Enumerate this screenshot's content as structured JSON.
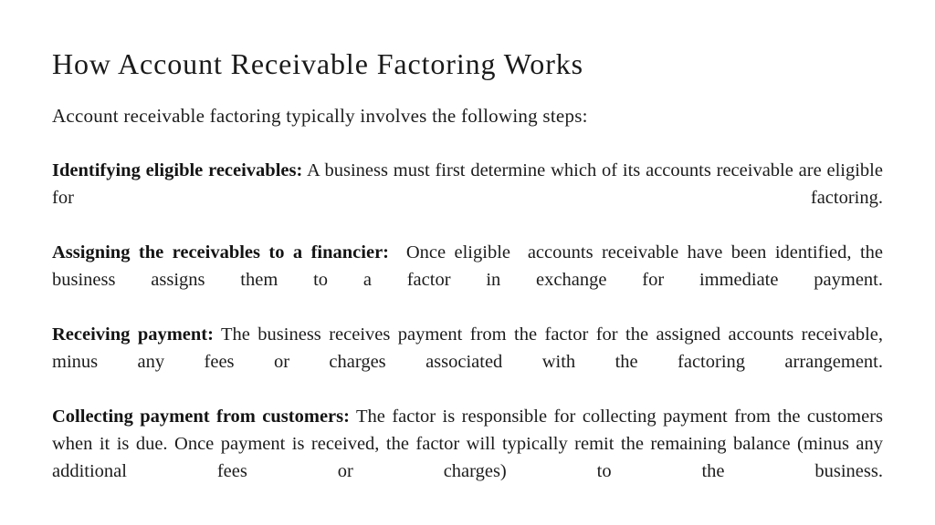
{
  "slide": {
    "title": "How Account Receivable Factoring Works",
    "intro": "Account receivable factoring typically involves the following steps:",
    "text_color": "#1c1c1c",
    "background_color": "#ffffff",
    "steps": [
      {
        "term": "Identifying eligible receivables:",
        "description": " A business must first determine which of its accounts receivable are eligible for factoring."
      },
      {
        "term": "Assigning the receivables to a financier:",
        "description": "  Once eligible  accounts receivable have been identified, the business assigns them to a factor in exchange for immediate payment."
      },
      {
        "term": "Receiving payment:",
        "description": " The business receives payment from the factor for the assigned accounts receivable, minus any fees or charges associated with the factoring arrangement."
      },
      {
        "term": "Collecting payment from customers:",
        "description": " The factor is responsible for collecting payment from the customers when it is due. Once payment is received, the factor will typically remit the remaining balance (minus any additional fees or charges) to the business."
      }
    ]
  }
}
